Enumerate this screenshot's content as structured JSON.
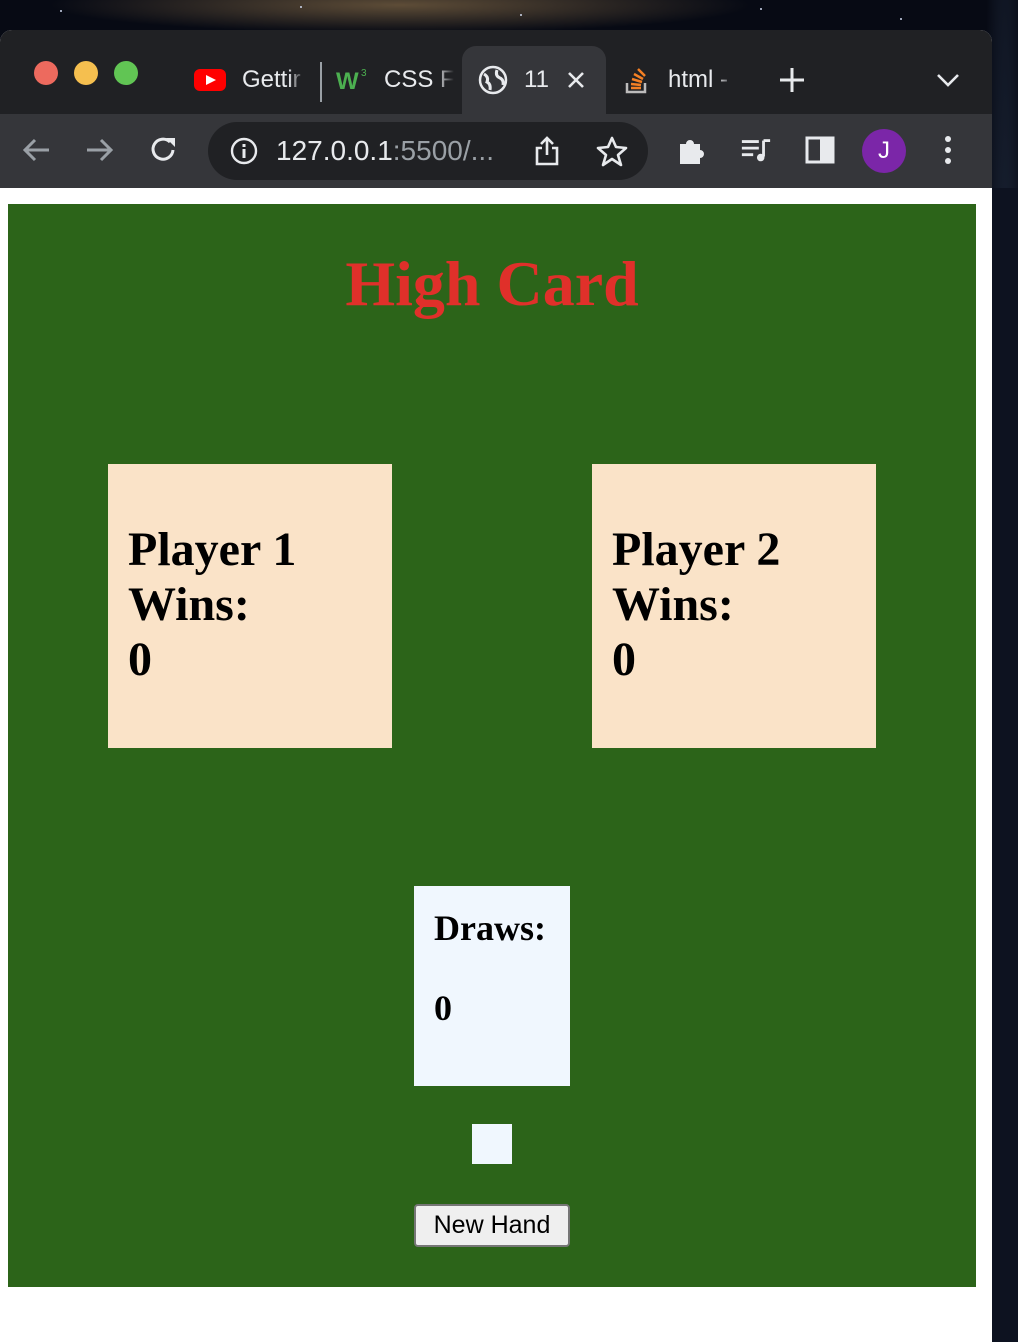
{
  "browser": {
    "tabs": [
      {
        "label": "Gettir",
        "icon": "youtube-icon",
        "active": false
      },
      {
        "label": "CSS F",
        "icon": "w3schools-icon",
        "active": false
      },
      {
        "label": "11",
        "icon": "globe-icon",
        "active": true
      },
      {
        "label": "html -",
        "icon": "stackoverflow-icon",
        "active": false
      }
    ],
    "url_host": "127.0.0.1",
    "url_rest": ":5500/...",
    "profile_initial": "J",
    "colors": {
      "tabbar": "#202124",
      "toolbar": "#35363a",
      "avatar": "#7b26a8"
    }
  },
  "game": {
    "title": "High Card",
    "player1": {
      "name": "Player 1",
      "wins_label": "Wins:",
      "wins": "0"
    },
    "player2": {
      "name": "Player 2",
      "wins_label": "Wins:",
      "wins": "0"
    },
    "draws": {
      "label": "Draws:",
      "value": "0"
    },
    "new_hand_label": "New Hand",
    "colors": {
      "table": "#2c6419",
      "title": "#e0302a",
      "player_card": "#fae3c8",
      "draws_card": "#f0f7fe"
    }
  }
}
